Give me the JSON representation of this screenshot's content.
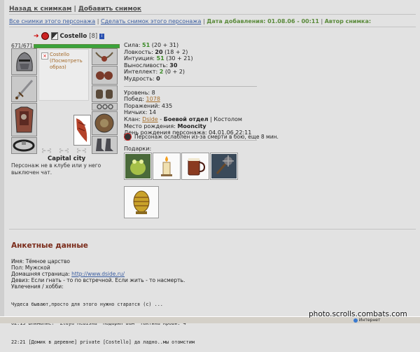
{
  "topnav": {
    "back": "Назад к снимкам",
    "sep": "|",
    "add": "Добавить снимок"
  },
  "subnav": {
    "all": "Все снимки этого персонажа",
    "make": "Сделать снимок этого персонажа",
    "date": "Дата добавления: 01.08.06 - 00:11",
    "author": "Автор снимка:"
  },
  "character": {
    "name": "Costello",
    "level": "[8]",
    "hp": "671/671",
    "hp_fraction": 1.0,
    "avatar_caption": "Costello\n(Посмотреть\nобраз)",
    "city": "Capital city",
    "club_text": "Персонаж не в клубе или у него выключен чат."
  },
  "stats": {
    "strength_label": "Сила:",
    "strength": "51",
    "strength_detail": "(20 + 31)",
    "agility_label": "Ловкость:",
    "agility": "20",
    "agility_detail": "(18 + 2)",
    "intuition_label": "Интуиция:",
    "intuition": "51",
    "intuition_detail": "(30 + 21)",
    "endurance_label": "Выносливость:",
    "endurance": "30",
    "intellect_label": "Интеллект:",
    "intellect": "2",
    "intellect_detail": "(0 + 2)",
    "wisdom_label": "Мудрость:",
    "wisdom": "0",
    "level_label": "Уровень:",
    "level": "8",
    "wins_label": "Побед:",
    "wins": "1078",
    "losses_label": "Поражений:",
    "losses": "435",
    "draws_label": "Ничьих:",
    "draws": "14",
    "clan_label": "Клан:",
    "clan_name": "Dside",
    "clan_dash": " - ",
    "clan_dept": "Боевой отдел",
    "clan_role": "| Костолом",
    "birthplace_label": "Место рождения:",
    "birthplace": "Mooncity",
    "birthday_label": "День рождения персонажа:",
    "birthday": "04.01.06 22:11"
  },
  "weakness_text": "Персонаж ослаблен из-за смерти в бою, еще 8 мин.",
  "gifts_label": "Подарки:",
  "gifts": [
    "frog",
    "candle",
    "mug",
    "mace",
    "egg"
  ],
  "profile": {
    "title": "Анкетные данные",
    "name_line": "Имя: Тёмное царство",
    "sex_line": "Пол: Мужской",
    "home_label": "Домашняя страница:",
    "home_url": "http://www.dside.ru/",
    "motto_line": "Девиз: Если гнать - то по встречной. Если жить - то насмерть.",
    "hobby_line": "Увлечения / хобби:",
    "chat": [
      "Чудеса бывают,просто для этого нужно старатся (с) ...",
      "02:13 Внимание! \"Zlaya Rediska\" подарил вам \"Тактика Крови: 4\"",
      "22:21 [Домик в деревне] private [Costello] да ладно..мы отомстим"
    ]
  },
  "statusbar": {
    "zone": "Интернет"
  },
  "watermark": "photo.scrolls.combats.com",
  "colors": {
    "accent_green": "#3a8a26",
    "link_blue": "#3a5da0",
    "link_brown": "#a66f2c",
    "title_red": "#7a2b1a"
  }
}
